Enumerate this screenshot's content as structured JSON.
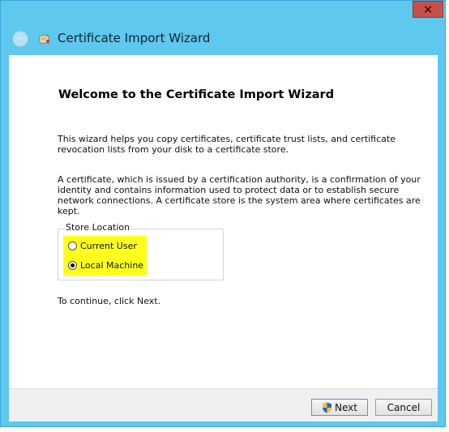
{
  "window": {
    "title": "Certificate Import Wizard",
    "close_glyph": "✕",
    "back_glyph": "←"
  },
  "content": {
    "heading": "Welcome to the Certificate Import Wizard",
    "paragraph1": "This wizard helps you copy certificates, certificate trust lists, and certificate revocation lists from your disk to a certificate store.",
    "paragraph2": "A certificate, which is issued by a certification authority, is a confirmation of your identity and contains information used to protect data or to establish secure network connections. A certificate store is the system area where certificates are kept.",
    "store_location": {
      "label": "Store Location",
      "options": [
        {
          "label": "Current User",
          "selected": false
        },
        {
          "label": "Local Machine",
          "selected": true
        }
      ]
    },
    "continue_text": "To continue, click Next."
  },
  "footer": {
    "next_label": "Next",
    "cancel_label": "Cancel"
  },
  "icons": {
    "back": "back-arrow-icon",
    "wizard": "certificate-wizard-icon",
    "close": "close-icon",
    "shield": "uac-shield-icon"
  },
  "colors": {
    "titlebar": "#5ec8ef",
    "close_button": "#c7504a",
    "highlight": "#ffff1e"
  }
}
